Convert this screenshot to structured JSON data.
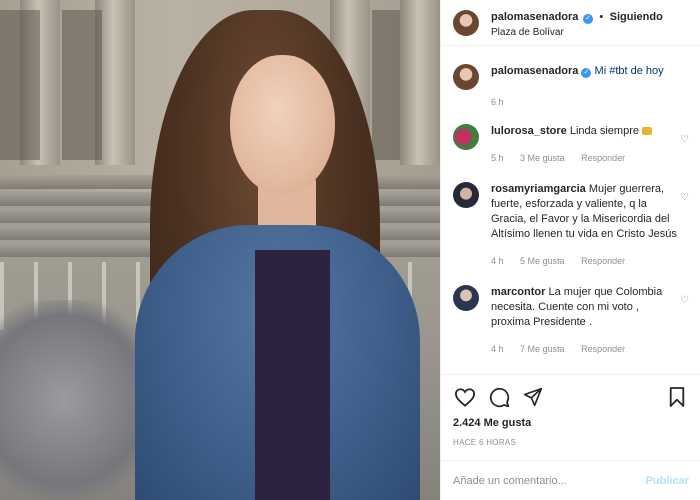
{
  "header": {
    "username": "palomasenadora",
    "separator": "•",
    "follow_status": "Siguiendo",
    "location": "Plaza de Bolívar"
  },
  "caption": {
    "username": "palomasenadora",
    "text": "Mi #tbt de hoy",
    "time": "6 h"
  },
  "comments": [
    {
      "username": "lulorosa_store",
      "text": "Linda siempre",
      "time": "5 h",
      "likes": "3 Me gusta",
      "reply": "Responder"
    },
    {
      "username": "rosamyriamgarcia",
      "text": "Mujer guerrera, fuerte, esforzada y valiente, q la Gracia, el Favor y la Misericordia del Altísimo llenen tu vida en Cristo Jesús",
      "time": "4 h",
      "likes": "5 Me gusta",
      "reply": "Responder"
    },
    {
      "username": "marcontor",
      "text": "La mujer que Colombia necesita. Cuente con mi voto , proxima Presidente .",
      "time": "4 h",
      "likes": "7 Me gusta",
      "reply": "Responder"
    }
  ],
  "actions": {
    "likes": "2.424 Me gusta",
    "timestamp": "HACE 6 HORAS"
  },
  "add_comment": {
    "placeholder": "Añade un comentario...",
    "post_label": "Publicar"
  },
  "colors": {
    "verified": "#3897f0",
    "post_disabled": "#b2dffc",
    "muted": "#8e8e8e"
  },
  "icons": [
    "verified-badge-icon",
    "heart-icon",
    "comment-icon",
    "share-icon",
    "bookmark-icon",
    "emoji-icon"
  ]
}
